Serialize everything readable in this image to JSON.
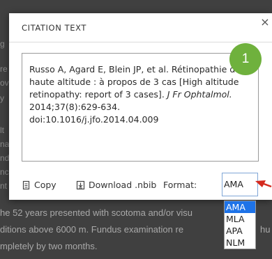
{
  "background": {
    "left_fragments": [
      "g",
      "re",
      "ov",
      "y",
      "lt",
      "na",
      "nd",
      "nc",
      "nt"
    ],
    "lines": [
      "he 52 years presented with scotoma and/or visu",
      "ditions above 6000 m. Fundus examination re",
      "mpletely by two months."
    ],
    "right_fragments": [
      "d",
      "hu"
    ]
  },
  "modal": {
    "title": "CITATION TEXT",
    "close_label": "×",
    "citation": {
      "text_main": "Russo A, Agard E, Blein JP, et al. Rétinopathie de haute altitude : à propos de 3 cas [High altitude retinopathy: report of 3 cases]. ",
      "journal": "J Fr Ophtalmol.",
      "text_tail": " 2014;37(8):629-634. doi:10.1016/j.jfo.2014.04.009"
    },
    "actions": {
      "copy_label": "Copy",
      "download_label": "Download .nbib",
      "format_label": "Format:"
    },
    "format_select": {
      "selected": "AMA",
      "options": [
        "AMA",
        "MLA",
        "APA",
        "NLM"
      ]
    }
  },
  "annotation": {
    "badge_number": "1",
    "badge_color": "#6fb13d",
    "arrow_color": "#d42a1e"
  }
}
